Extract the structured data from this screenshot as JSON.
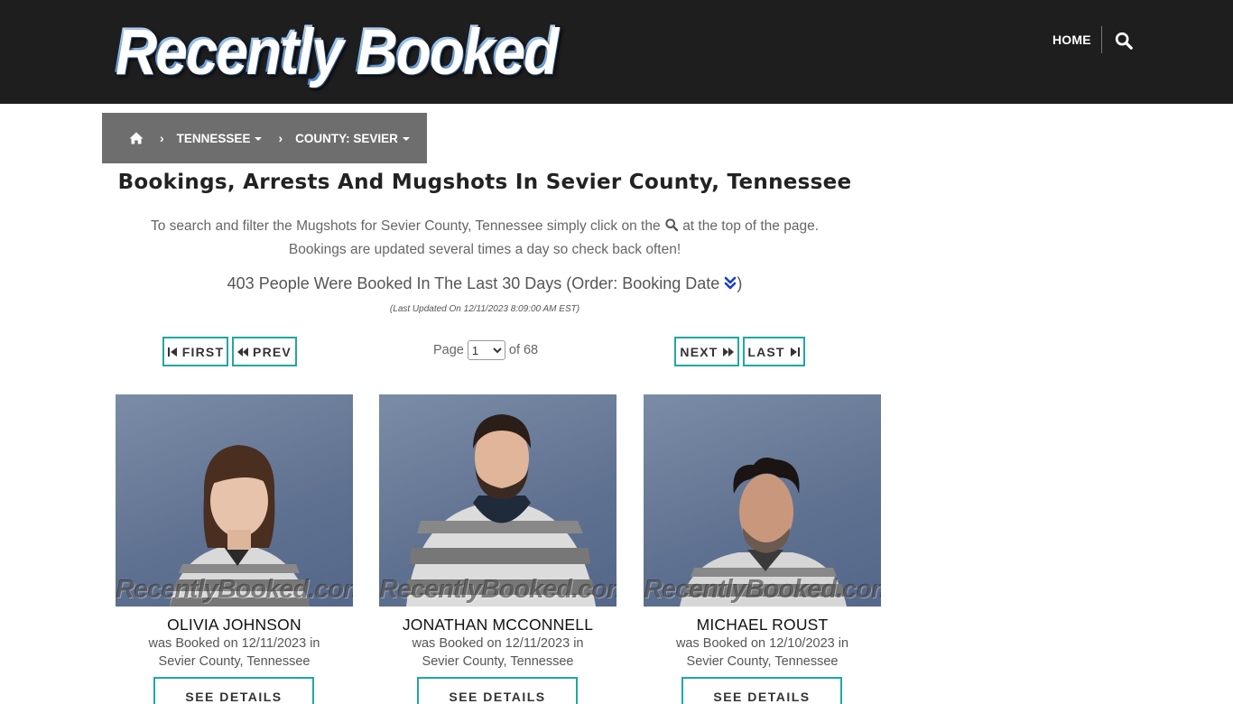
{
  "header": {
    "logo_text": "Recently Booked",
    "nav_home": "HOME"
  },
  "breadcrumb": {
    "state": "TENNESSEE",
    "county": "COUNTY: SEVIER"
  },
  "main": {
    "title": "Bookings, Arrests And Mugshots In Sevier County, Tennessee",
    "intro_line1_a": "To search and filter the Mugshots for Sevier County, Tennessee simply click on the",
    "intro_line1_b": "at the top of the page.",
    "intro_line2": "Bookings are updated several times a day so check back often!",
    "count_text": "403 People Were Booked In The Last 30 Days (Order: Booking Date",
    "count_close": ")",
    "last_updated": "(Last Updated On 12/11/2023 8:09:00 AM EST)"
  },
  "pagination": {
    "first": "FIRST",
    "prev": "PREV",
    "next": "NEXT",
    "last": "LAST",
    "page_label": "Page",
    "page_value": "1",
    "of_label": "of 68"
  },
  "cards": [
    {
      "name": "OLIVIA JOHNSON",
      "line1": "was Booked on 12/11/2023 in",
      "line2": "Sevier County, Tennessee",
      "button": "SEE DETAILS",
      "watermark": "RecentlyBooked.com"
    },
    {
      "name": "JONATHAN MCCONNELL",
      "line1": "was Booked on 12/11/2023 in",
      "line2": "Sevier County, Tennessee",
      "button": "SEE DETAILS",
      "watermark": "RecentlyBooked.com"
    },
    {
      "name": "MICHAEL ROUST",
      "line1": "was Booked on 12/10/2023 in",
      "line2": "Sevier County, Tennessee",
      "button": "SEE DETAILS",
      "watermark": "RecentlyBooked.com"
    }
  ],
  "colors": {
    "header_bg": "#1e1e1e",
    "breadcrumb_bg": "#6e6e6e",
    "accent": "#1fa8a0",
    "order_icon": "#1a3cc8"
  },
  "icons": {
    "home": "home-icon",
    "search": "search-icon",
    "order": "double-chevron-down-icon",
    "first": "step-backward-icon",
    "prev": "fast-backward-icon",
    "next": "fast-forward-icon",
    "last": "step-forward-icon"
  }
}
